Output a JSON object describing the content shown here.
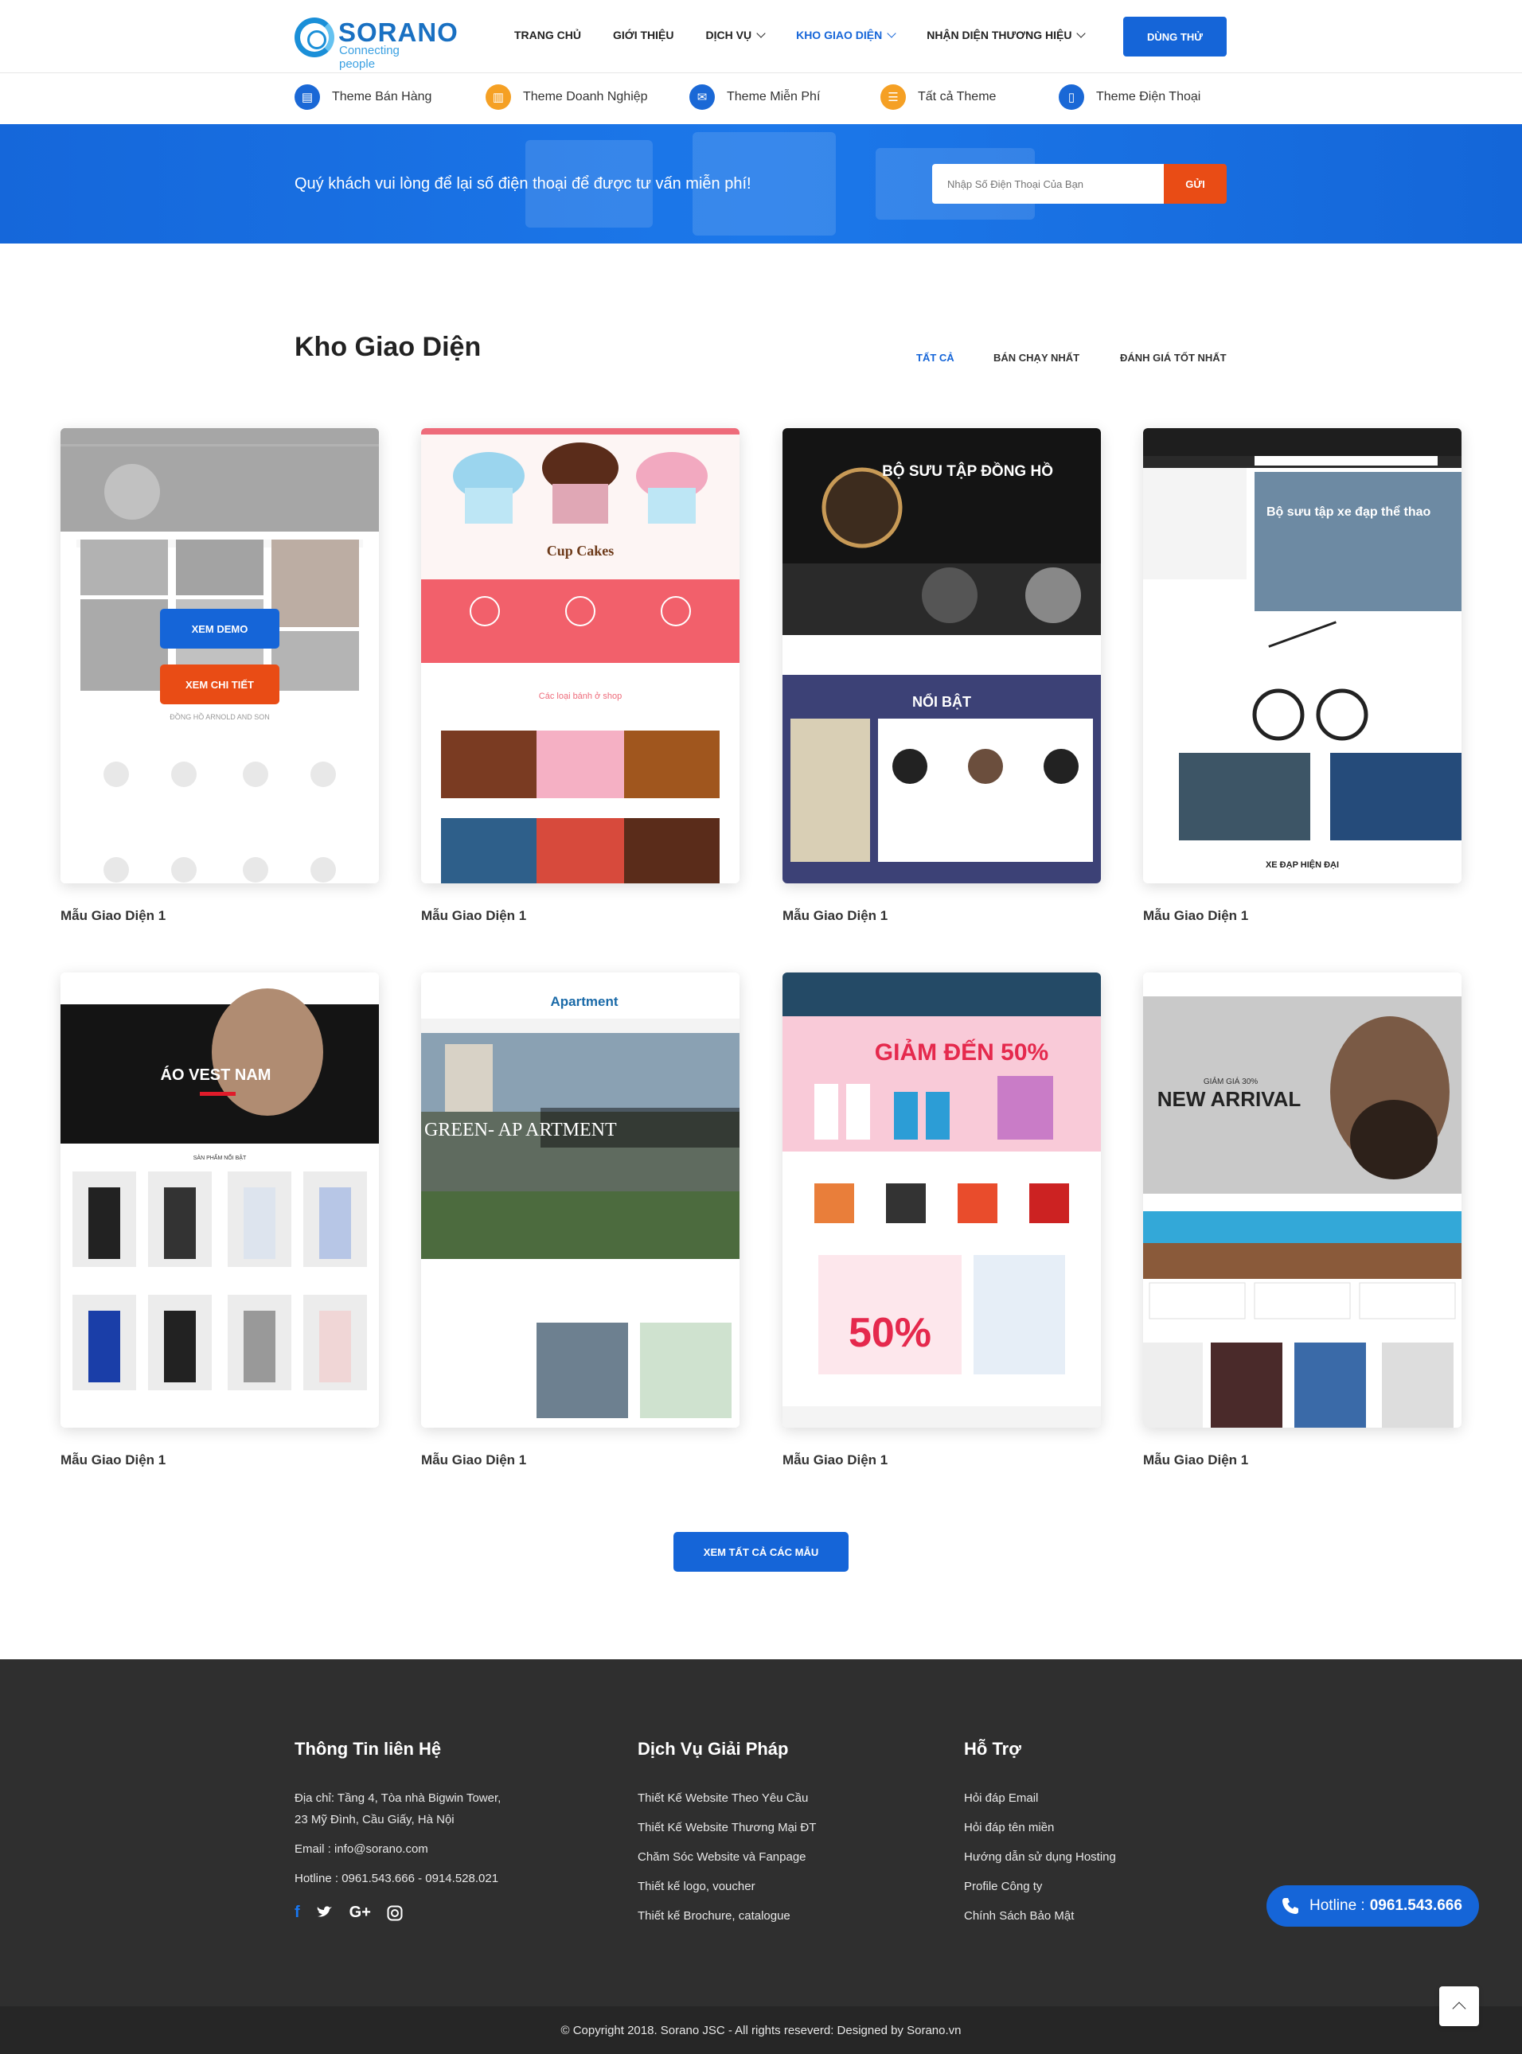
{
  "brand": {
    "name": "SORANO",
    "tagline": "Connecting people"
  },
  "nav": {
    "items": [
      "TRANG CHỦ",
      "GIỚI THIỆU",
      "DỊCH VỤ",
      "KHO GIAO DIỆN",
      "NHẬN DIỆN THƯƠNG HIỆU"
    ],
    "active": "KHO GIAO DIỆN",
    "try_label": "DÙNG THỬ"
  },
  "subnav": [
    "Theme Bán Hàng",
    "Theme Doanh Nghiệp",
    "Theme Miễn Phí",
    "Tất cả Theme",
    "Theme Điện Thoại"
  ],
  "banner": {
    "text": "Quý khách vui lòng để lại số điện thoại để được tư vấn miễn phí!",
    "placeholder": "Nhập Số Điện Thoại Của Bạn",
    "send_label": "GỬI"
  },
  "section": {
    "title": "Kho Giao Diện",
    "tabs": [
      "TẤT CẢ",
      "BÁN CHẠY NHẤT",
      "ĐÁNH GIÁ TỐT NHẤT"
    ],
    "active_tab": "TẤT CẢ"
  },
  "cards": [
    {
      "label": "Mẫu Giao Diện 1",
      "demo_label": "XEM DEMO",
      "detail_label": "XEM CHI TIẾT",
      "inner": "ĐỒNG HỒ ARNOLD AND SON"
    },
    {
      "label": "Mẫu Giao Diện 1",
      "inner": "Cup Cakes",
      "inner2": "Các loại bánh ở shop"
    },
    {
      "label": "Mẫu Giao Diện 1",
      "inner": "BỘ SƯU TẬP ĐỒNG HỒ",
      "inner2": "NỔI BẬT"
    },
    {
      "label": "Mẫu Giao Diện 1",
      "inner": "Bộ sưu tập xe đạp thể thao",
      "inner2": "XE ĐẠP HIỆN ĐẠI"
    },
    {
      "label": "Mẫu Giao Diện 1",
      "inner": "ÁO VEST NAM",
      "inner2": "SẢN PHẨM NỔI BẬT"
    },
    {
      "label": "Mẫu Giao Diện 1",
      "inner": "GREEN- AP ARTMENT",
      "inner2": "Apartment"
    },
    {
      "label": "Mẫu Giao Diện 1",
      "inner": "GIẢM ĐẾN 50%",
      "inner2": "50%"
    },
    {
      "label": "Mẫu Giao Diện 1",
      "inner": "NEW ARRIVAL",
      "inner2": "GIẢM GIÁ 30%"
    }
  ],
  "view_all_label": "XEM TẤT CẢ CÁC MẪU",
  "footer": {
    "contact": {
      "heading": "Thông Tin liên Hệ",
      "address_line1": "Địa chỉ: Tầng 4, Tòa nhà Bigwin Tower,",
      "address_line2": "23 Mỹ Đình, Cầu Giấy, Hà Nội",
      "email": "Email : info@sorano.com",
      "hotline": "Hotline : 0961.543.666 - 0914.528.021"
    },
    "services": {
      "heading": "Dịch Vụ Giải Pháp",
      "items": [
        "Thiết Kế Website Theo Yêu Cầu",
        "Thiết Kế Website Thương Mại ĐT",
        "Chăm Sóc Website và Fanpage",
        "Thiết kế logo, voucher",
        "Thiết kế Brochure, catalogue"
      ]
    },
    "support": {
      "heading": "Hỗ Trợ",
      "items": [
        "Hỏi đáp Email",
        "Hỏi đáp tên miền",
        "Hướng dẫn sử dụng Hosting",
        "Profile Công ty",
        "Chính Sách Bảo Mật"
      ]
    },
    "copyright": "© Copyright 2018. Sorano JSC - All rights reseverd: Designed by Sorano.vn"
  },
  "hotline_float": {
    "label": "Hotline :",
    "number": "0961.543.666"
  },
  "colors": {
    "primary": "#1565d8",
    "accent": "#e94c15",
    "footer_bg": "#2f2f2f"
  }
}
